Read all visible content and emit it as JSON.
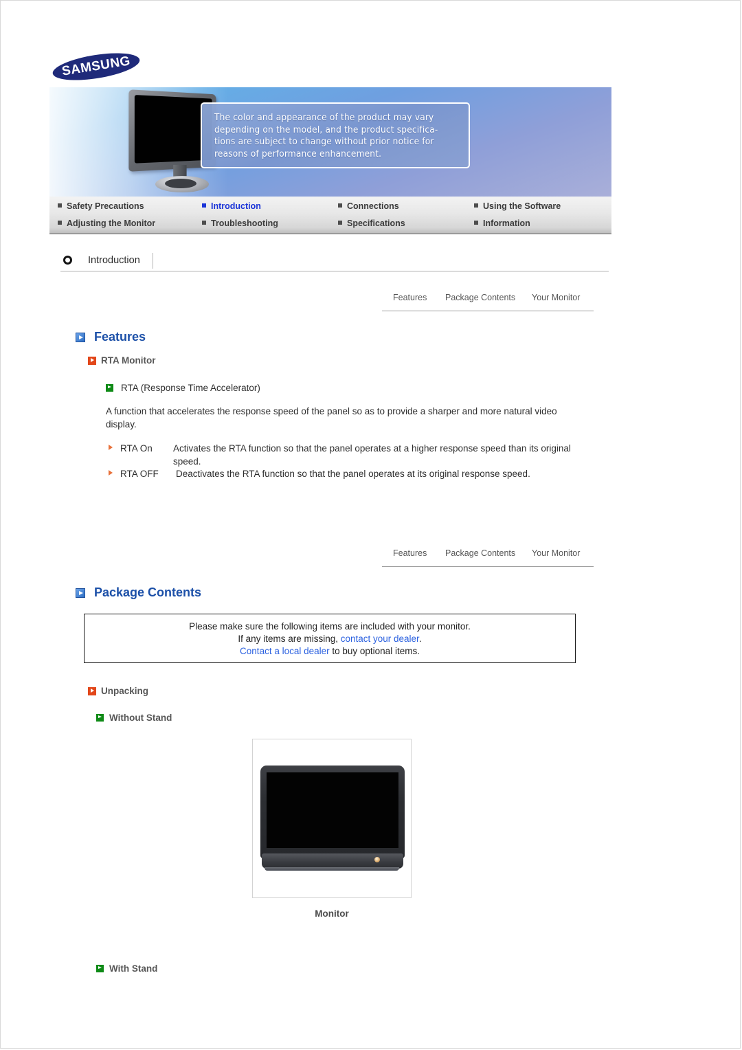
{
  "logo": {
    "text": "SAMSUNG"
  },
  "banner": {
    "notice_lines": [
      "The color and appearance of the product may vary",
      "depending on the model, and the product specifica-",
      "tions are subject to change without prior notice for",
      "reasons of performance enhancement."
    ]
  },
  "nav": {
    "items": [
      {
        "label": "Safety Precautions",
        "active": false
      },
      {
        "label": "Introduction",
        "active": true
      },
      {
        "label": "Connections",
        "active": false
      },
      {
        "label": "Using the Software",
        "active": false
      },
      {
        "label": "Adjusting the Monitor",
        "active": false
      },
      {
        "label": "Troubleshooting",
        "active": false
      },
      {
        "label": "Specifications",
        "active": false
      },
      {
        "label": "Information",
        "active": false
      }
    ],
    "active_color": "#1a34d8"
  },
  "section": {
    "title": "Introduction"
  },
  "subnav": {
    "features": "Features",
    "package_contents": "Package Contents",
    "your_monitor": "Your Monitor"
  },
  "features": {
    "heading": "Features",
    "rta_monitor": "RTA Monitor",
    "rta_full": "RTA (Response Time Accelerator)",
    "description": "A function that accelerates the response speed of the panel so as to provide a sharper and more natural video display.",
    "modes": [
      {
        "name": "RTA On",
        "desc": "Activates the RTA function so that the panel operates at a higher response speed than its original speed."
      },
      {
        "name": "RTA OFF",
        "desc": "Deactivates the RTA function so that the panel operates at its original response speed."
      }
    ]
  },
  "package": {
    "heading": "Package Contents",
    "notice": {
      "line1": "Please make sure the following items are included with your monitor.",
      "line2_pre": "If any items are missing, ",
      "line2_link": "contact your dealer",
      "line2_post": ".",
      "line3_link": "Contact a local dealer",
      "line3_post": " to buy optional items."
    },
    "unpacking": "Unpacking",
    "without_stand": "Without Stand",
    "with_stand": "With Stand",
    "monitor_caption": "Monitor"
  },
  "colors": {
    "heading_blue": "#1c50a8",
    "link_blue": "#2b61e0",
    "accent_red": "#e2471a",
    "accent_green": "#0e8a16"
  }
}
